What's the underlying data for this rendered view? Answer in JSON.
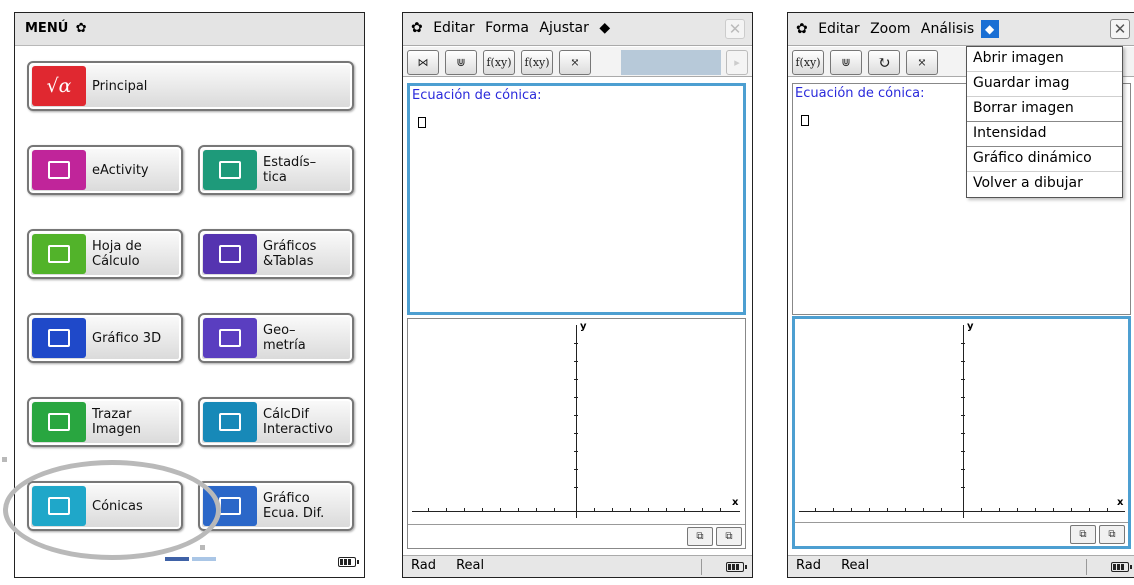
{
  "menu": {
    "title": "MENÚ",
    "apps": [
      {
        "label": "Principal",
        "icon": "sqrt-alpha-icon",
        "glyph": "√α",
        "color": "#e02830"
      },
      {
        "label": "eActivity",
        "icon": "eactivity-icon",
        "glyph": "✎",
        "color": "#c0259a"
      },
      {
        "label": "Estadís–\ntica",
        "icon": "statistics-icon",
        "glyph": "▥",
        "color": "#1e9a7a"
      },
      {
        "label": "Hoja de\nCálculo",
        "icon": "spreadsheet-icon",
        "glyph": "▦",
        "color": "#52b32a"
      },
      {
        "label": "Gráficos\n&Tablas",
        "icon": "graph-table-icon",
        "glyph": "⊞",
        "color": "#5534b0"
      },
      {
        "label": "Gráfico 3D",
        "icon": "graph3d-icon",
        "glyph": "⬚",
        "color": "#1f49c9"
      },
      {
        "label": "Geo–\nmetría",
        "icon": "geometry-icon",
        "glyph": "⟁",
        "color": "#5a3ec0"
      },
      {
        "label": "Trazar\nImagen",
        "icon": "picture-plot-icon",
        "glyph": "⤴",
        "color": "#29a640"
      },
      {
        "label": "CálcDif\nInteractivo",
        "icon": "diffcalc-icon",
        "glyph": "⌗",
        "color": "#1789b8"
      },
      {
        "label": "Cónicas",
        "icon": "conics-icon",
        "glyph": "⋈",
        "color": "#1fa7c9"
      },
      {
        "label": "Gráfico\nEcua. Dif.",
        "icon": "diffeq-graph-icon",
        "glyph": "▩",
        "color": "#2b67c8"
      }
    ]
  },
  "conics_screen": {
    "menu": [
      "Editar",
      "Forma",
      "Ajustar"
    ],
    "menu_diamond": "◆",
    "equation_label": "Ecuación de cónica:",
    "status": {
      "angle": "Rad",
      "mode": "Real"
    },
    "axis_y": "y",
    "axis_x": "x"
  },
  "conics_screen_menu_open": {
    "menu": [
      "Editar",
      "Zoom",
      "Análisis"
    ],
    "menu_diamond": "◆",
    "equation_label": "Ecuación de cónica:",
    "dropdown": [
      "Abrir imagen",
      "Guardar imag",
      "Borrar imagen",
      "Intensidad",
      "Gráfico dinámico",
      "Volver a dibujar"
    ],
    "status": {
      "angle": "Rad",
      "mode": "Real"
    },
    "axis_y": "y",
    "axis_x": "x"
  },
  "toolbar_icons": {
    "t1": "f(xy)",
    "t2": "f(xy)"
  },
  "colors": {
    "active_border": "#4d9fd1",
    "equation_text": "#2a2adb",
    "menu_diamond_bg": "#1a6fd4"
  }
}
